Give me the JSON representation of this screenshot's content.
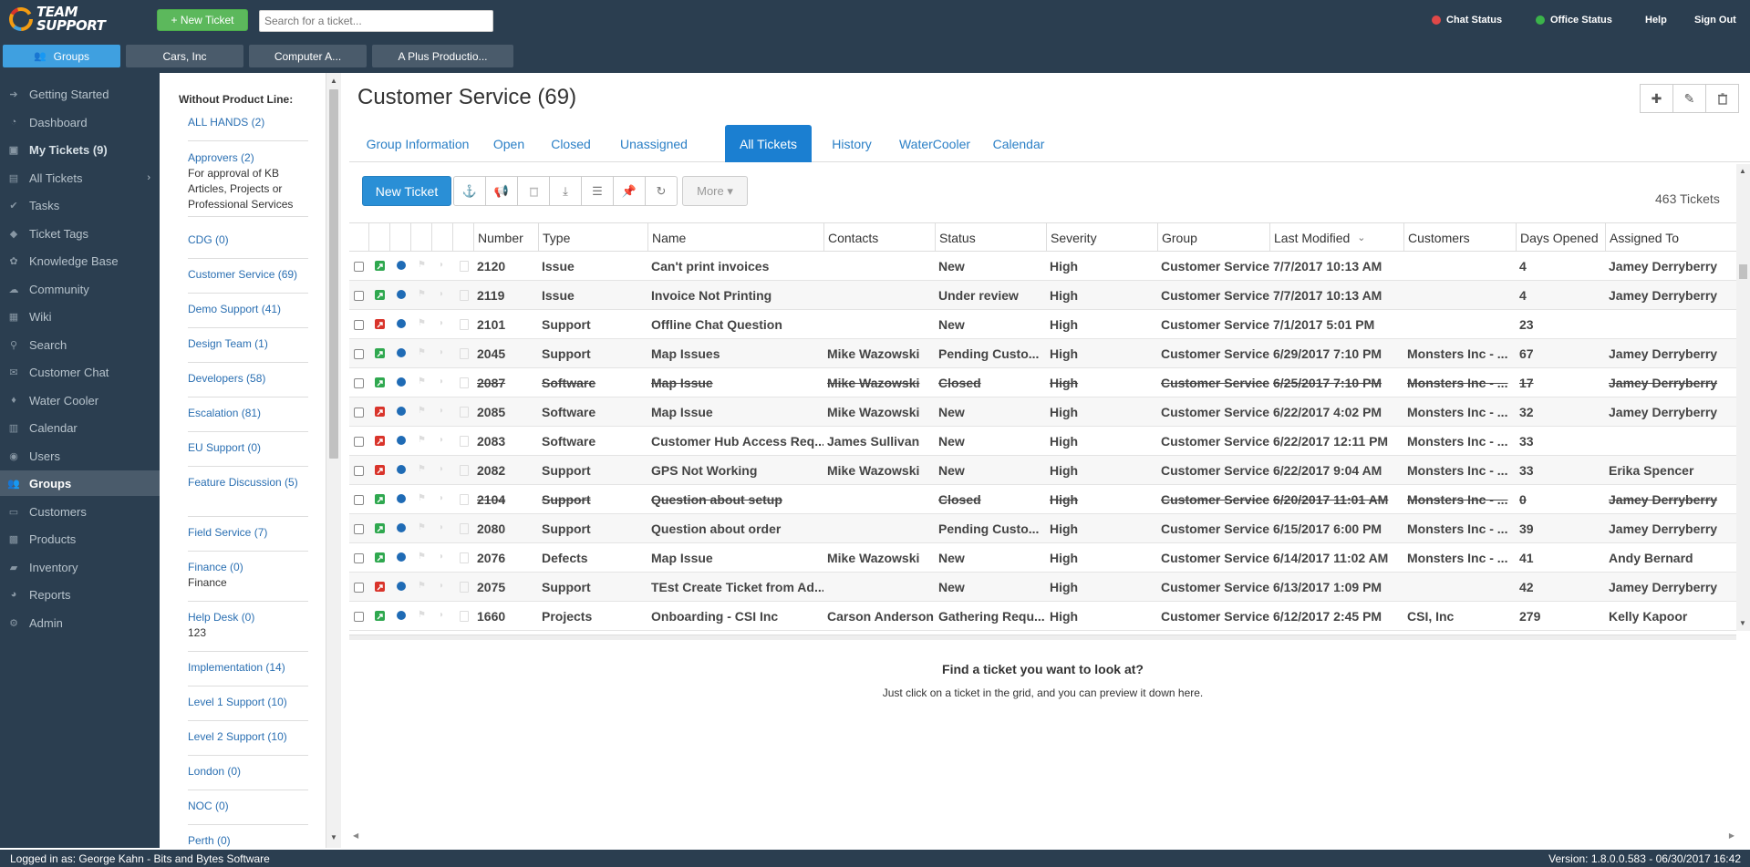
{
  "app": {
    "logo_text_line1": "TEAM",
    "logo_text_line2": "SUPPORT",
    "new_ticket_label": "+ New Ticket",
    "search_placeholder": "Search for a ticket...",
    "chat_status_label": "Chat Status",
    "chat_status_color": "#e04848",
    "office_status_label": "Office Status",
    "office_status_color": "#3bb34a",
    "help_label": "Help",
    "signout_label": "Sign Out"
  },
  "top_tabs": [
    {
      "label": "Groups",
      "icon": "users-icon",
      "active": true
    },
    {
      "label": "Cars, Inc",
      "active": false
    },
    {
      "label": "Computer A...",
      "active": false
    },
    {
      "label": "A Plus Productio...",
      "active": false
    }
  ],
  "nav": [
    {
      "label": "Getting Started",
      "icon": "arrow-right-icon"
    },
    {
      "label": "Dashboard",
      "icon": "dashboard-icon"
    },
    {
      "label": "My Tickets (9)",
      "icon": "inbox-icon",
      "bold": true
    },
    {
      "label": "All Tickets",
      "icon": "tickets-icon",
      "chevron": true
    },
    {
      "label": "Tasks",
      "icon": "check-icon"
    },
    {
      "label": "Ticket Tags",
      "icon": "tag-icon"
    },
    {
      "label": "Knowledge Base",
      "icon": "knowledge-icon"
    },
    {
      "label": "Community",
      "icon": "community-icon"
    },
    {
      "label": "Wiki",
      "icon": "wiki-icon"
    },
    {
      "label": "Search",
      "icon": "search-icon"
    },
    {
      "label": "Customer Chat",
      "icon": "chat-icon"
    },
    {
      "label": "Water Cooler",
      "icon": "drop-icon"
    },
    {
      "label": "Calendar",
      "icon": "calendar-icon"
    },
    {
      "label": "Users",
      "icon": "user-icon"
    },
    {
      "label": "Groups",
      "icon": "users-icon",
      "active": true
    },
    {
      "label": "Customers",
      "icon": "briefcase-icon"
    },
    {
      "label": "Products",
      "icon": "box-icon"
    },
    {
      "label": "Inventory",
      "icon": "truck-icon"
    },
    {
      "label": "Reports",
      "icon": "pie-icon"
    },
    {
      "label": "Admin",
      "icon": "gear-icon"
    }
  ],
  "groups_panel": {
    "heading": "Without Product Line:",
    "groups": [
      {
        "name": "ALL HANDS (2)"
      },
      {
        "name": "Approvers (2)",
        "desc": "For approval of KB Articles, Projects or Professional Services"
      },
      {
        "name": "CDG (0)"
      },
      {
        "name": "Customer Service (69)"
      },
      {
        "name": "Demo Support (41)"
      },
      {
        "name": "Design Team (1)"
      },
      {
        "name": "Developers (58)"
      },
      {
        "name": "Escalation (81)"
      },
      {
        "name": "EU Support (0)"
      },
      {
        "name": "Feature Discussion (5)"
      },
      {
        "name": "Field Service (7)"
      },
      {
        "name": "Finance (0)",
        "desc": "Finance"
      },
      {
        "name": "Help Desk (0)",
        "desc": "123"
      },
      {
        "name": "Implementation (14)"
      },
      {
        "name": "Level 1 Support (10)"
      },
      {
        "name": "Level 2 Support (10)"
      },
      {
        "name": "London (0)"
      },
      {
        "name": "NOC (0)"
      },
      {
        "name": "Perth (0)"
      }
    ]
  },
  "main": {
    "title": "Customer Service (69)",
    "tabs": [
      {
        "label": "Group Information"
      },
      {
        "label": "Open"
      },
      {
        "label": "Closed"
      },
      {
        "label": "Unassigned"
      },
      {
        "label": "All Tickets",
        "active": true
      },
      {
        "label": "History"
      },
      {
        "label": "WaterCooler"
      },
      {
        "label": "Calendar"
      }
    ],
    "toolbar": {
      "new_ticket": "New Ticket",
      "more": "More ▾",
      "buttons": [
        "anchor-icon",
        "megaphone-icon",
        "trash-icon",
        "download-icon",
        "list-icon",
        "pin-icon",
        "refresh-icon"
      ]
    },
    "ticket_count": "463 Tickets",
    "columns": [
      "Number",
      "Type",
      "Name",
      "Contacts",
      "Status",
      "Severity",
      "Group",
      "Last Modified",
      "Customers",
      "Days Opened",
      "Assigned To"
    ],
    "sort_indicator": "⌄",
    "rows": [
      {
        "number": "2120",
        "type": "Issue",
        "name": "Can't print invoices",
        "contacts": "",
        "status": "New",
        "severity": "High",
        "group": "Customer Service",
        "modified": "7/7/2017 10:13 AM",
        "customers": "",
        "days": "4",
        "assigned": "Jamey Derryberry",
        "closed": false,
        "type_color": "#2fa84f"
      },
      {
        "number": "2119",
        "type": "Issue",
        "name": "Invoice Not Printing",
        "contacts": "",
        "status": "Under review",
        "severity": "High",
        "group": "Customer Service",
        "modified": "7/7/2017 10:13 AM",
        "customers": "",
        "days": "4",
        "assigned": "Jamey Derryberry",
        "closed": false,
        "type_color": "#2fa84f"
      },
      {
        "number": "2101",
        "type": "Support",
        "name": "Offline Chat Question",
        "contacts": "",
        "status": "New",
        "severity": "High",
        "group": "Customer Service",
        "modified": "7/1/2017 5:01 PM",
        "customers": "",
        "days": "23",
        "assigned": "",
        "closed": false,
        "type_color": "#d9342b"
      },
      {
        "number": "2045",
        "type": "Support",
        "name": "Map Issues",
        "contacts": "Mike Wazowski",
        "status": "Pending Custo...",
        "severity": "High",
        "group": "Customer Service",
        "modified": "6/29/2017 7:10 PM",
        "customers": "Monsters Inc - ...",
        "days": "67",
        "assigned": "Jamey Derryberry",
        "closed": false,
        "type_color": "#2fa84f"
      },
      {
        "number": "2087",
        "type": "Software",
        "name": "Map Issue",
        "contacts": "Mike Wazowski",
        "status": "Closed",
        "severity": "High",
        "group": "Customer Service",
        "modified": "6/25/2017 7:10 PM",
        "customers": "Monsters Inc - ...",
        "days": "17",
        "assigned": "Jamey Derryberry",
        "closed": true,
        "type_color": "#2fa84f"
      },
      {
        "number": "2085",
        "type": "Software",
        "name": "Map Issue",
        "contacts": "Mike Wazowski",
        "status": "New",
        "severity": "High",
        "group": "Customer Service",
        "modified": "6/22/2017 4:02 PM",
        "customers": "Monsters Inc - ...",
        "days": "32",
        "assigned": "Jamey Derryberry",
        "closed": false,
        "type_color": "#d9342b"
      },
      {
        "number": "2083",
        "type": "Software",
        "name": "Customer Hub Access Req...",
        "contacts": "James Sullivan",
        "status": "New",
        "severity": "High",
        "group": "Customer Service",
        "modified": "6/22/2017 12:11 PM",
        "customers": "Monsters Inc - ...",
        "days": "33",
        "assigned": "",
        "closed": false,
        "type_color": "#d9342b"
      },
      {
        "number": "2082",
        "type": "Support",
        "name": "GPS Not Working",
        "contacts": "Mike Wazowski",
        "status": "New",
        "severity": "High",
        "group": "Customer Service",
        "modified": "6/22/2017 9:04 AM",
        "customers": "Monsters Inc - ...",
        "days": "33",
        "assigned": "Erika Spencer",
        "closed": false,
        "type_color": "#d9342b"
      },
      {
        "number": "2104",
        "type": "Support",
        "name": "Question about setup",
        "contacts": "",
        "status": "Closed",
        "severity": "High",
        "group": "Customer Service",
        "modified": "6/20/2017 11:01 AM",
        "customers": "Monsters Inc - ...",
        "days": "0",
        "assigned": "Jamey Derryberry",
        "closed": true,
        "type_color": "#2fa84f"
      },
      {
        "number": "2080",
        "type": "Support",
        "name": "Question about order",
        "contacts": "",
        "status": "Pending Custo...",
        "severity": "High",
        "group": "Customer Service",
        "modified": "6/15/2017 6:00 PM",
        "customers": "Monsters Inc - ...",
        "days": "39",
        "assigned": "Jamey Derryberry",
        "closed": false,
        "type_color": "#2fa84f"
      },
      {
        "number": "2076",
        "type": "Defects",
        "name": "Map Issue",
        "contacts": "Mike Wazowski",
        "status": "New",
        "severity": "High",
        "group": "Customer Service",
        "modified": "6/14/2017 11:02 AM",
        "customers": "Monsters Inc - ...",
        "days": "41",
        "assigned": "Andy Bernard",
        "closed": false,
        "type_color": "#2fa84f"
      },
      {
        "number": "2075",
        "type": "Support",
        "name": "TEst Create Ticket from Ad...",
        "contacts": "",
        "status": "New",
        "severity": "High",
        "group": "Customer Service",
        "modified": "6/13/2017 1:09 PM",
        "customers": "",
        "days": "42",
        "assigned": "Jamey Derryberry",
        "closed": false,
        "type_color": "#d9342b"
      },
      {
        "number": "1660",
        "type": "Projects",
        "name": "Onboarding - CSI Inc",
        "contacts": "Carson Anderson",
        "status": "Gathering Requ...",
        "severity": "High",
        "group": "Customer Service",
        "modified": "6/12/2017 2:45 PM",
        "customers": "CSI, Inc",
        "days": "279",
        "assigned": "Kelly Kapoor",
        "closed": false,
        "type_color": "#2fa84f"
      }
    ],
    "preview_title": "Find a ticket you want to look at?",
    "preview_sub": "Just click on a ticket in the grid, and you can preview it down here."
  },
  "footer": {
    "logged_in": "Logged in as: George Kahn - Bits and Bytes Software",
    "version": "Version: 1.8.0.0.583 - 06/30/2017 16:42"
  }
}
